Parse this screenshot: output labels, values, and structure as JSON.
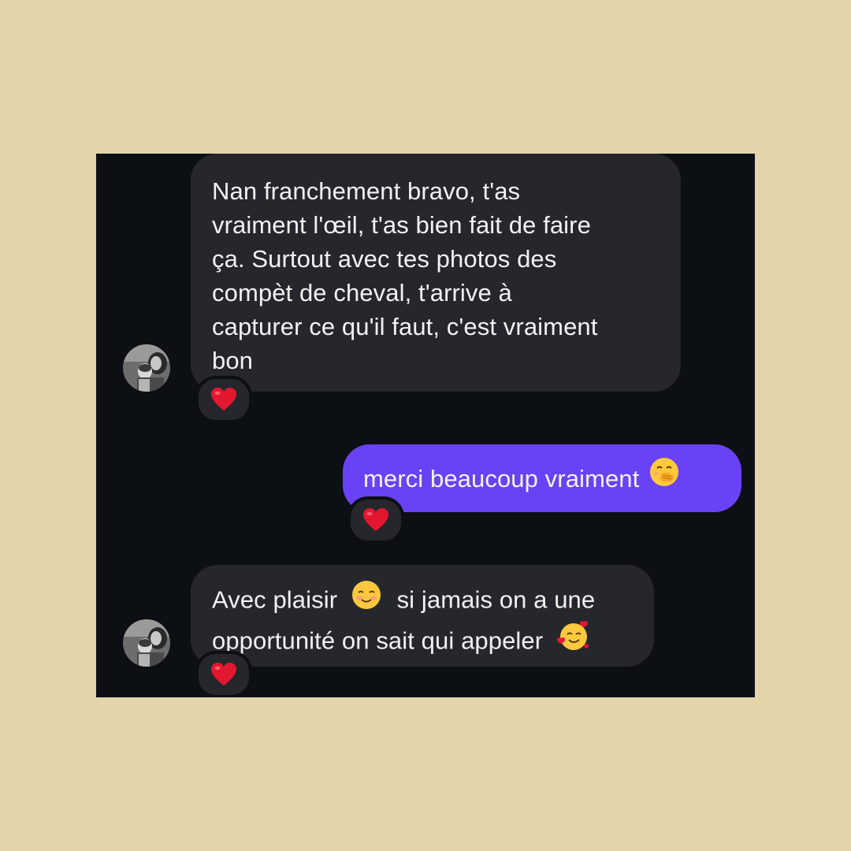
{
  "messages": [
    {
      "direction": "incoming",
      "text": "Nan franchement bravo, t'as\nvraiment l'œil, t'as bien fait de faire\nça. Surtout avec tes photos des\ncompèt de cheval, t'arrive à\ncapturer ce qu'il faut, c'est vraiment\nbon",
      "reaction": "heart-icon"
    },
    {
      "direction": "outgoing",
      "text": "merci beaucoup vraiment",
      "emoji": "hand-over-mouth-emoji-icon",
      "reaction": "heart-icon"
    },
    {
      "direction": "incoming",
      "line1_before": "Avec plaisir",
      "line1_after": "si jamais on a une",
      "line2": "opportunité on sait qui appeler",
      "emoji_1": "smiling-blush-emoji-icon",
      "emoji_2": "smiling-face-with-hearts-emoji-icon",
      "reaction": "heart-icon"
    }
  ],
  "colors": {
    "page_background": "#e3d5a9",
    "chat_background": "#0c0f14",
    "incoming_bubble": "#25272d",
    "outgoing_bubble": "#6a42f5",
    "text": "#f2f2f4",
    "reaction_heart": "#e3172f"
  }
}
